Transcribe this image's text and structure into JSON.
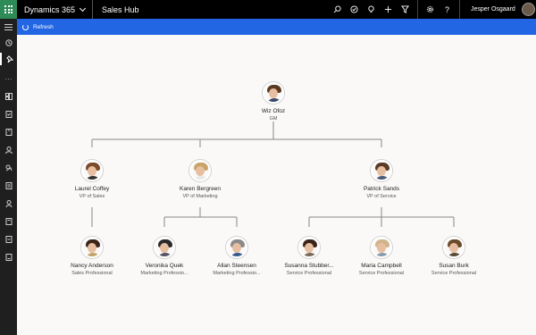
{
  "header": {
    "app_title": "Dynamics 365",
    "hub": "Sales Hub",
    "user_name": "Jesper Osgaard",
    "icons": [
      "search-icon",
      "task-icon",
      "lightbulb-icon",
      "plus-icon",
      "filter-icon",
      "gear-icon",
      "help-icon"
    ]
  },
  "command_bar": {
    "refresh_label": "Refresh"
  },
  "left_nav": {
    "icons": [
      "hamburger-icon",
      "recent-icon",
      "pin-icon",
      "more-icon",
      "dashboard-icon",
      "activities-icon",
      "accounts-icon",
      "contacts-icon",
      "leads-icon",
      "opportunities-icon",
      "competitors-icon",
      "quotes-icon",
      "orders-icon",
      "invoices-icon"
    ]
  },
  "org": {
    "root": {
      "name": "Wiz Ofoz",
      "title": "GM"
    },
    "level1": [
      {
        "name": "Laurel Coffey",
        "title": "VP of Sales"
      },
      {
        "name": "Karen Bergreen",
        "title": "VP of Marketing"
      },
      {
        "name": "Patrick Sands",
        "title": "VP of Service"
      }
    ],
    "level2": [
      {
        "name": "Nancy Anderson",
        "title": "Sales Professional"
      },
      {
        "name": "Veronika Quek",
        "title": "Marketing Professio..."
      },
      {
        "name": "Allan Steensen",
        "title": "Marketing Professio..."
      },
      {
        "name": "Susanna Stubber...",
        "title": "Service Professional"
      },
      {
        "name": "Maria Campbell",
        "title": "Service Professional"
      },
      {
        "name": "Susan Burk",
        "title": "Service Professional"
      }
    ]
  },
  "colors": {
    "topbar": "#000000",
    "waffle": "#2e8b57",
    "command_bar": "#2266e3",
    "canvas": "#faf9f8",
    "connector": "#8a8886"
  }
}
